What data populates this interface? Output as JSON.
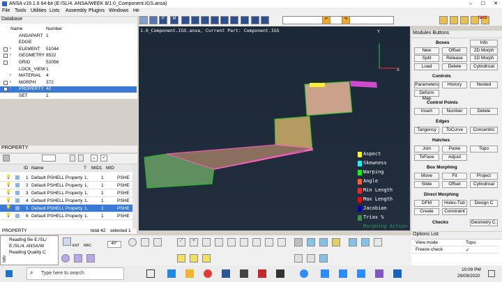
{
  "titlebar": {
    "title": "ANSA v19.1.6 64-bit (E:/SL/4. ANSA/WEEK 8/1.0_Component.IGS.ansa)",
    "min": "–",
    "max": "☐",
    "close": "✕"
  },
  "menu": [
    "File",
    "Tools",
    "Utilities",
    "Lists",
    "Assembly",
    "Plugins",
    "Windows",
    "Help"
  ],
  "database": {
    "title": "Database",
    "col_name": "Name",
    "col_number": "Number",
    "rows": [
      {
        "name": "ANSAPART",
        "num": "1"
      },
      {
        "name": "EDGE",
        "num": ""
      },
      {
        "name": "ELEMENT",
        "num": "51044"
      },
      {
        "name": "GEOMETRY",
        "num": "8522"
      },
      {
        "name": "GRID",
        "num": "52056"
      },
      {
        "name": "LOCK_VIEW",
        "num": "1"
      },
      {
        "name": "MATERIAL",
        "num": "4"
      },
      {
        "name": "MORPH",
        "num": "372"
      },
      {
        "name": "PROPERTY",
        "num": "42"
      },
      {
        "name": "SET",
        "num": "1"
      }
    ]
  },
  "property": {
    "title": "PROPERTY",
    "col_id": "ID",
    "col_name": "Name",
    "col_t": "T",
    "col_mid1": "MID1",
    "col_mid": "MID",
    "rows": [
      {
        "id": "1",
        "name": "Default PSHELL Property",
        "t": "1.",
        "mid1": "1",
        "type": "PSHE"
      },
      {
        "id": "2",
        "name": "Default PSHELL Property",
        "t": "1.",
        "mid1": "1",
        "type": "PSHE"
      },
      {
        "id": "3",
        "name": "Default PSHELL Property",
        "t": "1.",
        "mid1": "1",
        "type": "PSHE"
      },
      {
        "id": "4",
        "name": "Default PSHELL Property",
        "t": "1.",
        "mid1": "1",
        "type": "PSHE"
      },
      {
        "id": "5",
        "name": "Default PSHELL Property",
        "t": "1.",
        "mid1": "1",
        "type": "PSHE"
      },
      {
        "id": "6",
        "name": "Default PSHELL Property",
        "t": "1.",
        "mid1": "1",
        "type": "PSHE"
      }
    ],
    "status_name": "PROPERTY",
    "status_total": "total 42",
    "status_selected": "selected 1"
  },
  "info": {
    "label": "Info",
    "log": [
      "Reading file E:/SL/",
      "E:/SL/4. ANSA/W",
      "Reading Quality C"
    ]
  },
  "viewport": {
    "title": "1.0_Component.IGS.ansa,  Current Part: Component.IGS",
    "axis_x": "X",
    "axis_y": "Y",
    "legend": [
      {
        "label": "Aspect",
        "color": "#ffff00"
      },
      {
        "label": "Skewness",
        "color": "#00ffff"
      },
      {
        "label": "Warping",
        "color": "#00ff00"
      },
      {
        "label": "Angle",
        "color": "#ff6020"
      },
      {
        "label": "Min Length",
        "color": "#ff2020"
      },
      {
        "label": "Max Length",
        "color": "#ff0000"
      },
      {
        "label": "Jacobian",
        "color": "#0000c0"
      },
      {
        "label": "Trias %",
        "color": "#409040"
      },
      {
        "label": "Morphing Action",
        "color": ""
      }
    ],
    "toolbar_angle": "40°",
    "entity_ent": "ENT",
    "entity_mac": "MAC"
  },
  "modules": {
    "title": "Modules Buttons",
    "nas_badge": "NAS",
    "boxes_label": "Boxes",
    "info": "Info",
    "new": "New",
    "offset": "Offset",
    "morph2d": "2D Morph",
    "split": "Split",
    "release": "Release",
    "morph1d": "1D Morph",
    "load": "Load",
    "delete": "Delete",
    "cylindrical": "Cylindrical",
    "controls_label": "Controls",
    "parameters": "Parameters",
    "history": "History",
    "nested": "Nested",
    "deform_map": "Deform Map",
    "control_points_label": "Control Points",
    "insert": "Insert",
    "number": "Number",
    "cp_delete": "Delete",
    "edges_label": "Edges",
    "tangency": "Tangency",
    "to_curve": "ToCurve",
    "concentric": "Concentric",
    "hatches_label": "Hatches",
    "join": "Join",
    "paste": "Paste",
    "topo": "Topo",
    "to_face": "ToFace",
    "adjust": "Adjust",
    "box_morphing_label": "Box Morphing",
    "move": "Move",
    "fit": "Fit",
    "project": "Project",
    "slide": "Slide",
    "bm_offset": "Offset",
    "bm_cylindrical": "Cylindrical",
    "direct_morphing_label": "Direct Morphing",
    "dfm": "DFM",
    "holes_tub": "Holes-Tub",
    "design_c": "Design C",
    "create": "Create",
    "constraint": "Constraint",
    "checks_label": "Checks",
    "geometry_c": "Geometry C."
  },
  "options_list": {
    "title": "Options List",
    "rows": [
      {
        "name": "View mode",
        "value": "Topo"
      },
      {
        "name": "Freeze check",
        "value": "✔"
      }
    ]
  },
  "taskbar": {
    "search": "Type here to search",
    "time": "10:09 PM",
    "date": "29/09/2020"
  }
}
